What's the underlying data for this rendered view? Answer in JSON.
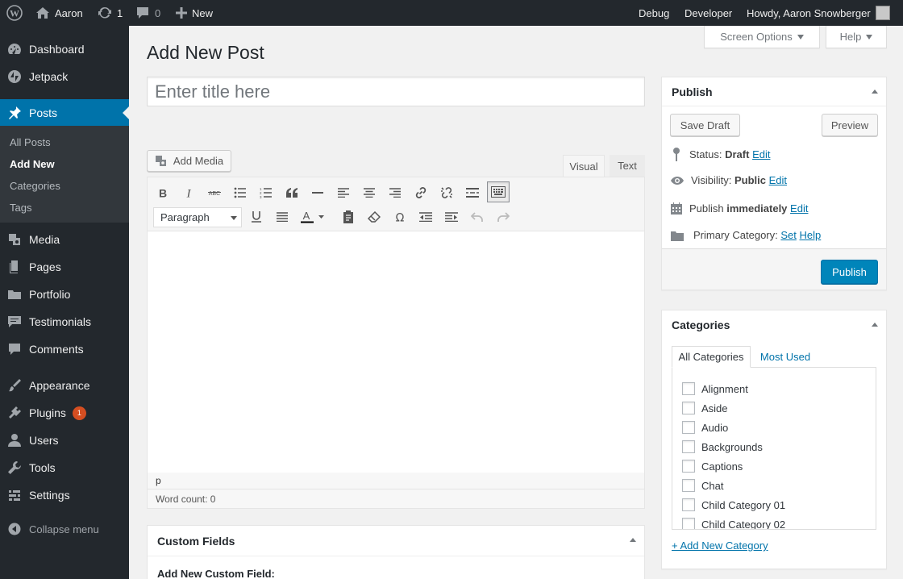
{
  "admin_bar": {
    "site_name": "Aaron",
    "updates_count": "1",
    "comments_count": "0",
    "new_label": "New",
    "debug": "Debug",
    "developer": "Developer",
    "howdy": "Howdy, Aaron Snowberger"
  },
  "sidebar": {
    "items": [
      {
        "label": "Dashboard",
        "icon": "dashboard-icon"
      },
      {
        "label": "Jetpack",
        "icon": "jetpack-icon"
      },
      {
        "label": "Posts",
        "icon": "pin-icon"
      },
      {
        "label": "Media",
        "icon": "media-icon"
      },
      {
        "label": "Pages",
        "icon": "pages-icon"
      },
      {
        "label": "Portfolio",
        "icon": "portfolio-icon"
      },
      {
        "label": "Testimonials",
        "icon": "testimonial-icon"
      },
      {
        "label": "Comments",
        "icon": "comments-icon"
      },
      {
        "label": "Appearance",
        "icon": "brush-icon"
      },
      {
        "label": "Plugins",
        "icon": "plugin-icon",
        "badge": "1"
      },
      {
        "label": "Users",
        "icon": "users-icon"
      },
      {
        "label": "Tools",
        "icon": "wrench-icon"
      },
      {
        "label": "Settings",
        "icon": "settings-icon"
      }
    ],
    "submenu": [
      "All Posts",
      "Add New",
      "Categories",
      "Tags"
    ],
    "collapse": "Collapse menu"
  },
  "screen_options": "Screen Options",
  "help": "Help",
  "page_title": "Add New Post",
  "title_placeholder": "Enter title here",
  "add_media": "Add Media",
  "editor_tabs": {
    "visual": "Visual",
    "text": "Text"
  },
  "format_select": "Paragraph",
  "editor_path": "p",
  "word_count": "Word count: 0",
  "custom_fields": {
    "title": "Custom Fields",
    "add_new": "Add New Custom Field:"
  },
  "publish": {
    "title": "Publish",
    "save_draft": "Save Draft",
    "preview": "Preview",
    "status_label": "Status:",
    "status_value": "Draft",
    "visibility_label": "Visibility:",
    "visibility_value": "Public",
    "publish_label": "Publish",
    "publish_value": "immediately",
    "primary_category_label": "Primary Category:",
    "set": "Set",
    "help": "Help",
    "edit": "Edit",
    "publish_button": "Publish"
  },
  "categories": {
    "title": "Categories",
    "tab_all": "All Categories",
    "tab_most_used": "Most Used",
    "items": [
      "Alignment",
      "Aside",
      "Audio",
      "Backgrounds",
      "Captions",
      "Chat",
      "Child Category 01",
      "Child Category 02"
    ],
    "add_new": "+ Add New Category"
  },
  "colors": {
    "primary": "#0085ba",
    "admin_bar": "#23282d",
    "menu_current": "#0073aa",
    "badge": "#d54e21"
  }
}
